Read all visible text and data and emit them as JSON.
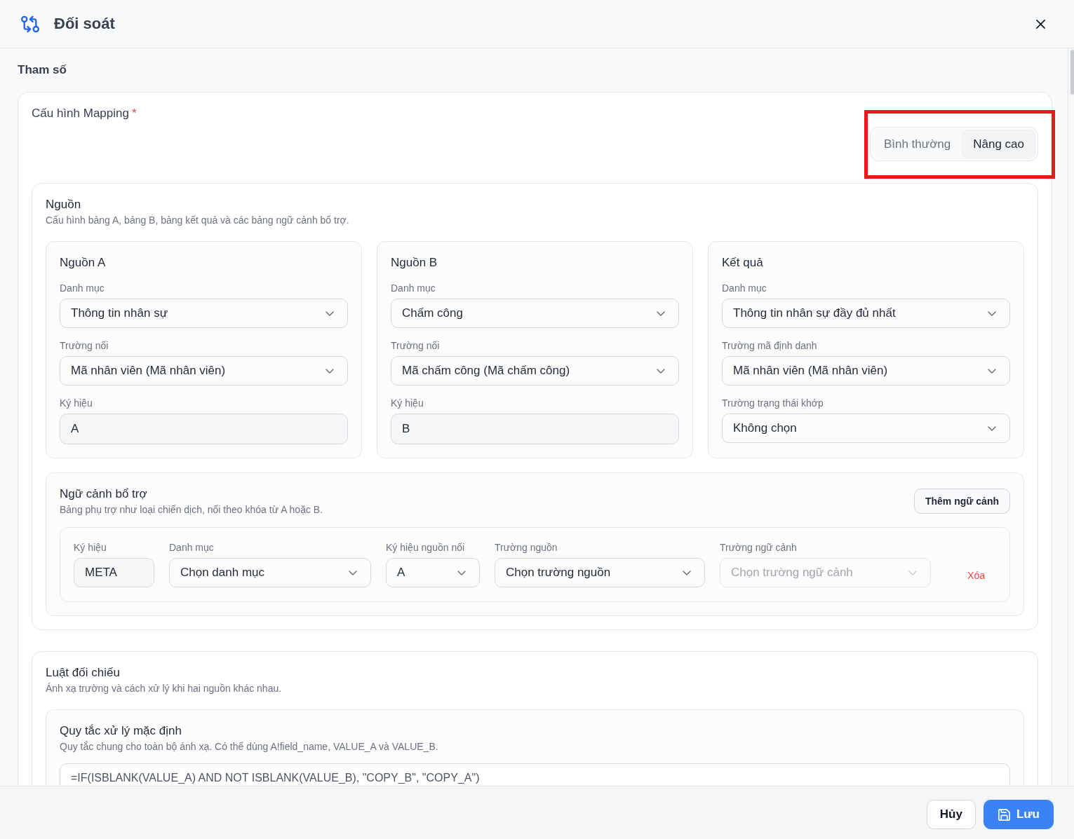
{
  "window": {
    "title": "Đối soát"
  },
  "parameters": {
    "heading": "Tham số"
  },
  "mapping_config": {
    "title": "Cấu hình Mapping",
    "required_mark": "*",
    "mode_switch": {
      "highlighted": true,
      "options": [
        {
          "label": "Bình thường",
          "selected": false
        },
        {
          "label": "Nâng cao",
          "selected": true
        }
      ]
    }
  },
  "sources": {
    "title": "Nguồn",
    "subtitle": "Cấu hình bảng A, bảng B, bảng kết quả và các bảng ngữ cảnh bổ trợ.",
    "panels": [
      {
        "title": "Nguồn A",
        "fields": [
          {
            "label": "Danh mục",
            "kind": "select",
            "value": "Thông tin nhân sự"
          },
          {
            "label": "Trường nối",
            "kind": "select",
            "value": "Mã nhân viên (Mã nhân viên)"
          },
          {
            "label": "Ký hiệu",
            "kind": "input",
            "value": "A"
          }
        ]
      },
      {
        "title": "Nguồn B",
        "fields": [
          {
            "label": "Danh mục",
            "kind": "select",
            "value": "Chấm công"
          },
          {
            "label": "Trường nối",
            "kind": "select",
            "value": "Mã chấm công (Mã chấm công)"
          },
          {
            "label": "Ký hiệu",
            "kind": "input",
            "value": "B"
          }
        ]
      },
      {
        "title": "Kết quả",
        "fields": [
          {
            "label": "Danh mục",
            "kind": "select",
            "value": "Thông tin nhân sự đầy đủ nhất"
          },
          {
            "label": "Trường mã định danh",
            "kind": "select",
            "value": "Mã nhân viên (Mã nhân viên)"
          },
          {
            "label": "Trường trạng thái khớp",
            "kind": "select",
            "value": "Không chọn"
          }
        ]
      }
    ],
    "context": {
      "title": "Ngữ cảnh bổ trợ",
      "subtitle": "Bảng phụ trợ như loại chiến dịch, nối theo khóa từ A hoặc B.",
      "add_button": "Thêm ngữ cảnh",
      "rows": [
        {
          "fields": [
            {
              "label": "Ký hiệu",
              "kind": "input",
              "value": "META",
              "disabled": false
            },
            {
              "label": "Danh mục",
              "kind": "select",
              "value": "Chọn danh mục",
              "disabled": false
            },
            {
              "label": "Ký hiệu nguồn nối",
              "kind": "select",
              "value": "A",
              "disabled": false
            },
            {
              "label": "Trường nguồn",
              "kind": "select",
              "value": "Chọn trường nguồn",
              "disabled": false
            },
            {
              "label": "Trường ngữ cảnh",
              "kind": "select",
              "value": "Chọn trường ngữ cảnh",
              "disabled": true
            }
          ],
          "delete_label": "Xóa"
        }
      ]
    }
  },
  "rules": {
    "title": "Luật đối chiếu",
    "subtitle": "Ánh xạ trường và cách xử lý khi hai nguồn khác nhau.",
    "default_rule": {
      "title": "Quy tắc xử lý mặc định",
      "subtitle": "Quy tắc chung cho toàn bộ ánh xạ. Có thể dùng A!field_name, VALUE_A và VALUE_B.",
      "formula": "=IF(ISBLANK(VALUE_A) AND NOT ISBLANK(VALUE_B), \"COPY_B\", \"COPY_A\")"
    }
  },
  "footer": {
    "buttons": [
      {
        "label": "Hủy",
        "kind": "secondary"
      },
      {
        "label": "Lưu",
        "kind": "primary"
      }
    ]
  }
}
